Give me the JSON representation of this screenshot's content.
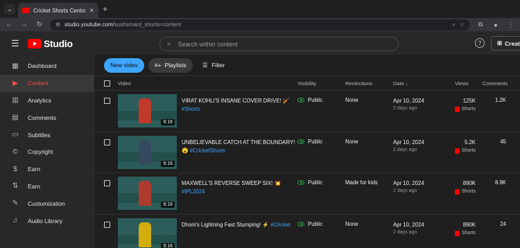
{
  "browser": {
    "tab_title": "Cricket Shorts Central",
    "url_main": "studio.youtube.com/",
    "url_rest": "sushsmard_shorts=content"
  },
  "header": {
    "logo_text": "Studio",
    "search_placeholder": "Search within content",
    "create_label": "Create"
  },
  "sidebar": {
    "items": [
      {
        "label": "Dashboard",
        "icon": "dashboard-icon",
        "glyph": "▦",
        "active": false
      },
      {
        "label": "Content",
        "icon": "content-icon",
        "glyph": "▶",
        "active": true
      },
      {
        "label": "Analytics",
        "icon": "analytics-icon",
        "glyph": "▥",
        "active": false
      },
      {
        "label": "Comments",
        "icon": "comments-icon",
        "glyph": "▤",
        "active": false
      },
      {
        "label": "Subtitles",
        "icon": "subtitles-icon",
        "glyph": "▭",
        "active": false
      },
      {
        "label": "Copyright",
        "icon": "copyright-icon",
        "glyph": "©",
        "active": false
      },
      {
        "label": "Earn",
        "icon": "earn-icon",
        "glyph": "$",
        "active": false
      },
      {
        "label": "Earn",
        "icon": "earn-icon",
        "glyph": "⇅",
        "active": false
      },
      {
        "label": "Customization",
        "icon": "customization-icon",
        "glyph": "✎",
        "active": false
      },
      {
        "label": "Audio Library",
        "icon": "audio-library-icon",
        "glyph": "♫",
        "active": false
      }
    ]
  },
  "toolbar": {
    "new_video": "New video",
    "playlists": "Playlists",
    "filter": "Filter"
  },
  "table": {
    "headers": {
      "video": "Video",
      "visibility": "Visibility",
      "restrictions": "Restrictions",
      "date": "Date",
      "views": "Views",
      "comments": "Comments"
    },
    "rows": [
      {
        "title": "VIRAT KOHLI'S INSANE COVER DRIVE! 🏏",
        "tag": "#Shorts",
        "duration": "9:16",
        "visibility": "Public",
        "restriction": "None",
        "date": "Apr 10, 2024",
        "ago": "2 days ago",
        "views": "125K",
        "type": "Shorts",
        "comments": "1.2K",
        "thumb_color": "#c0392b"
      },
      {
        "title": "UNBELIEVABLE CATCH AT THE BOUNDARY!",
        "tag": "😮 #CricketShorts",
        "duration": "9:16",
        "visibility": "Public",
        "restriction": "None",
        "date": "Apr 10, 2024",
        "ago": "2 days ago",
        "views": "5.2K",
        "type": "Shorts",
        "comments": "45",
        "thumb_color": "#34495e"
      },
      {
        "title": "MAXWELL'S REVERSE SWEEP SIX! 💥",
        "tag": "#IPL2024",
        "duration": "9:16",
        "visibility": "Public",
        "restriction": "Made for kids",
        "date": "Apr 10, 2024",
        "ago": "2 days ago",
        "views": "890K",
        "type": "Shorts",
        "comments": "8.9K",
        "thumb_color": "#b03a2e"
      },
      {
        "title": "Dhoni's Lightning Fast Stumping! ⚡",
        "tag": "#Cricket",
        "duration": "9:16",
        "visibility": "Public",
        "restriction": "None",
        "date": "Apr 10, 2024",
        "ago": "2 days ago",
        "views": "890K",
        "type": "Shorts",
        "comments": "24",
        "thumb_color": "#d4ac0d"
      }
    ]
  }
}
